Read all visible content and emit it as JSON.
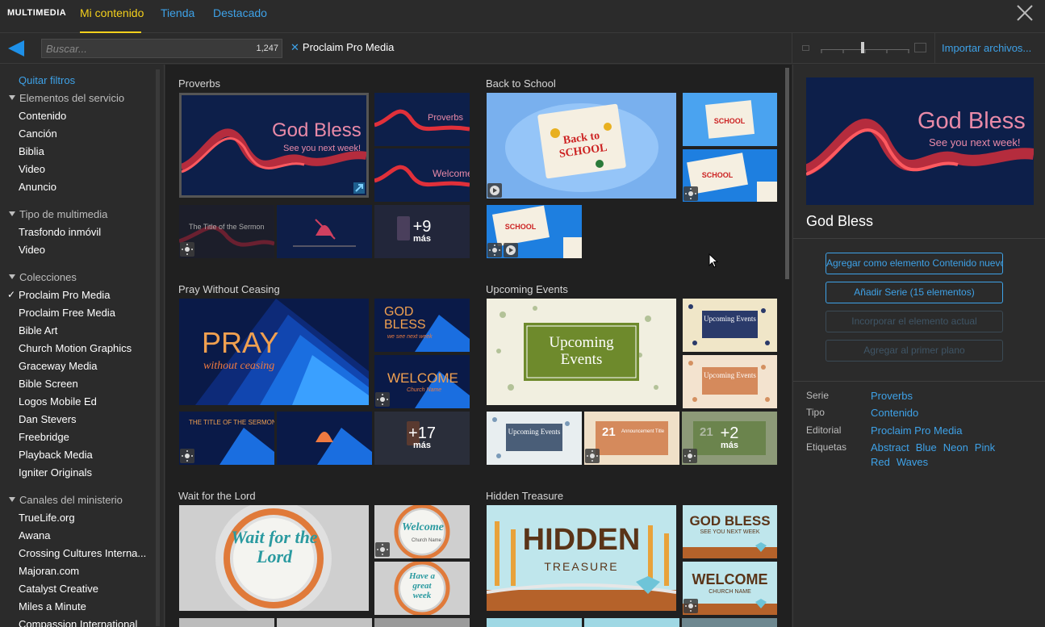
{
  "topbar": {
    "brand": "MULTIMEDIA",
    "tabs": [
      {
        "label": "Mi contenido",
        "active": true
      },
      {
        "label": "Tienda",
        "active": false
      },
      {
        "label": "Destacado",
        "active": false
      }
    ]
  },
  "search": {
    "placeholder": "Buscar...",
    "count": "1,247",
    "active_filter": "Proclaim Pro Media"
  },
  "right_header": {
    "import_label": "Importar archivos..."
  },
  "sidebar": {
    "clear_filters": "Quitar filtros",
    "sections": [
      {
        "title": "Elementos del servicio",
        "items": [
          "Contenido",
          "Canción",
          "Biblia",
          "Video",
          "Anuncio"
        ]
      },
      {
        "title": "Tipo de multimedia",
        "items": [
          "Trasfondo inmóvil",
          "Video"
        ]
      },
      {
        "title": "Colecciones",
        "items": [
          "Proclaim Pro Media",
          "Proclaim Free Media",
          "Bible Art",
          "Church Motion Graphics",
          "Graceway Media",
          "Bible Screen",
          "Logos Mobile Ed",
          "Dan Stevers",
          "Freebridge",
          "Playback Media",
          "Igniter Originals"
        ]
      },
      {
        "title": "Canales del ministerio",
        "items": [
          "TrueLife.org",
          "Awana",
          "Crossing Cultures Interna...",
          "Majoran.com",
          "Catalyst Creative",
          "Miles a Minute",
          "Compassion International"
        ]
      }
    ]
  },
  "groups": [
    {
      "title": "Proverbs",
      "main_text": "God Bless",
      "main_sub": "See you next week!",
      "small": [
        "Proverbs",
        "Welcome"
      ],
      "bottom": [
        "The Title of the Sermon",
        "",
        ""
      ],
      "more": "+9",
      "more_label": "más"
    },
    {
      "title": "Back to School",
      "main_text": "Back to School",
      "more": "",
      "more_label": ""
    },
    {
      "title": "Pray Without Ceasing",
      "main_text": "PRAY",
      "main_sub": "without ceasing",
      "small": [
        "GOD BLESS",
        "WELCOME"
      ],
      "small_sub": [
        "we see next week",
        "Church Name"
      ],
      "bottom": [
        "THE TITLE OF THE SERMON",
        "",
        ""
      ],
      "more": "+17",
      "more_label": "más"
    },
    {
      "title": "Upcoming Events",
      "main_text": "Upcoming Events",
      "small": [
        "Upcoming Events",
        "Upcoming Events"
      ],
      "bottom": [
        "Upcoming Events",
        "21",
        "21"
      ],
      "bottom_sub": "Announcement Title",
      "more": "+2",
      "more_label": "más"
    },
    {
      "title": "Wait for the Lord",
      "main_text": "Wait for the Lord",
      "small": [
        "Welcome",
        "Have a great week"
      ],
      "small_sub": [
        "Church Name",
        ""
      ]
    },
    {
      "title": "Hidden Treasure",
      "main_text": "HIDDEN",
      "main_sub": "TREASURE",
      "small": [
        "GOD BLESS",
        "WELCOME"
      ],
      "small_sub": [
        "SEE YOU NEXT WEEK",
        "CHURCH NAME"
      ]
    }
  ],
  "details": {
    "title": "God Bless",
    "preview_text": "God Bless",
    "preview_sub": "See you next week!",
    "buttons": [
      {
        "label": "Agregar como elemento Contenido nuevo",
        "enabled": true
      },
      {
        "label": "Añadir Serie (15 elementos)",
        "enabled": true
      },
      {
        "label": "Incorporar el elemento actual",
        "enabled": false
      },
      {
        "label": "Agregar al primer plano",
        "enabled": false
      }
    ],
    "meta": [
      {
        "label": "Serie",
        "value": "Proverbs"
      },
      {
        "label": "Tipo",
        "value": "Contenido"
      },
      {
        "label": "Editorial",
        "value": "Proclaim Pro Media"
      }
    ],
    "tags_label": "Etiquetas",
    "tags": [
      "Abstract",
      "Blue",
      "Neon",
      "Pink",
      "Red",
      "Waves"
    ]
  },
  "colors": {
    "accent": "#3ea2e8",
    "active_tab": "#f4d01c",
    "panel_bg": "#2b2b2b",
    "content_bg": "#202020"
  }
}
